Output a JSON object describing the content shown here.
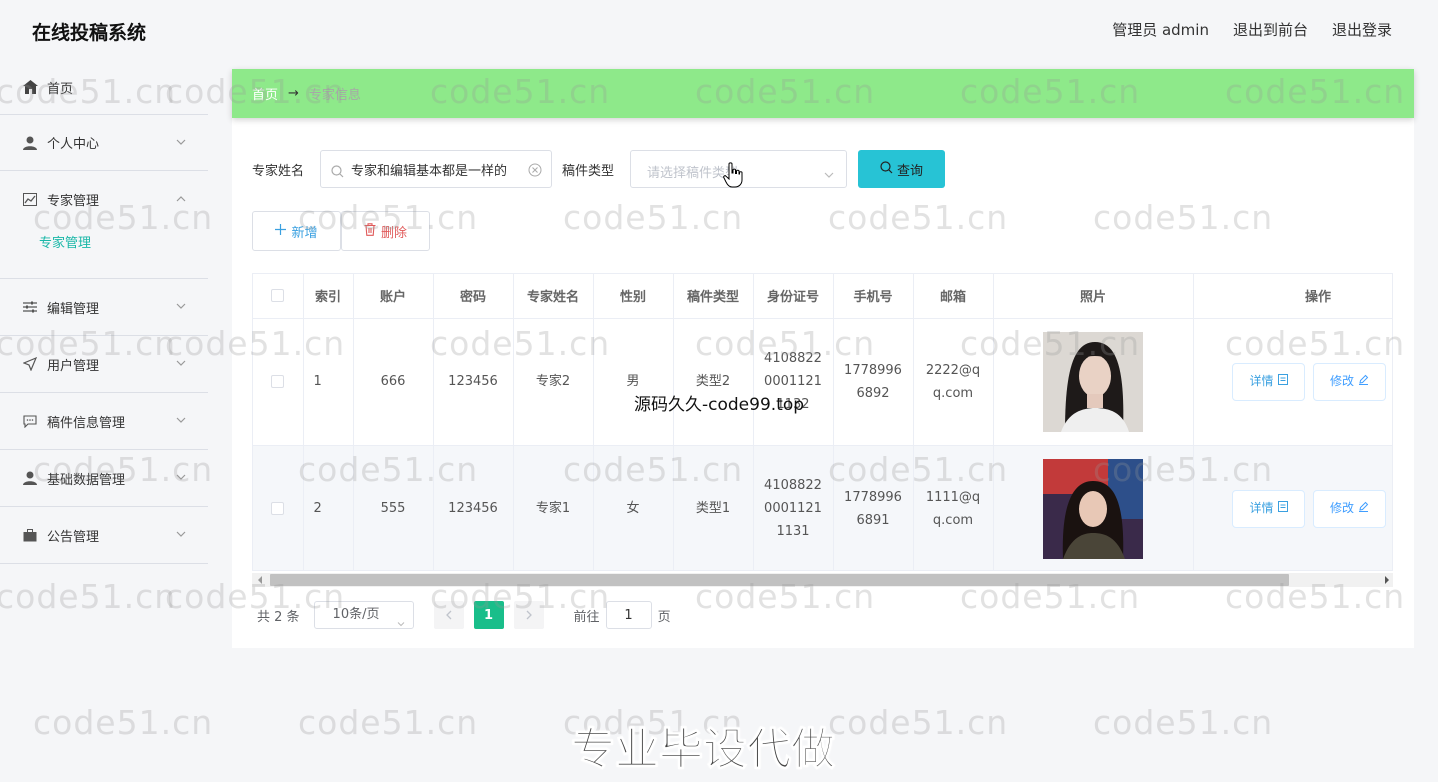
{
  "app": {
    "title": "在线投稿系统"
  },
  "header_links": {
    "admin": "管理员 admin",
    "to_front": "退出到前台",
    "logout": "退出登录"
  },
  "sidebar": {
    "home": "首页",
    "personal": "个人中心",
    "expert_mgmt": "专家管理",
    "expert_sub": "专家管理",
    "editor_mgmt": "编辑管理",
    "user_mgmt": "用户管理",
    "manuscript_mgmt": "稿件信息管理",
    "basic_data_mgmt": "基础数据管理",
    "notice_mgmt": "公告管理"
  },
  "breadcrumb": {
    "home": "首页",
    "arrow": "→",
    "current": "专家信息"
  },
  "filters": {
    "name_label": "专家姓名",
    "name_value": "专家和编辑基本都是一样的",
    "type_label": "稿件类型",
    "type_placeholder": "请选择稿件类型",
    "query_label": "查询"
  },
  "actions": {
    "add": "新增",
    "delete": "删除"
  },
  "table": {
    "columns": [
      "索引",
      "账户",
      "密码",
      "专家姓名",
      "性别",
      "稿件类型",
      "身份证号",
      "手机号",
      "邮箱",
      "照片",
      "操作"
    ],
    "rows": [
      {
        "index": "1",
        "account": "666",
        "password": "123456",
        "name": "专家2",
        "gender": "男",
        "type": "类型2",
        "id_card": "410882200011211132",
        "phone": "17789966892",
        "email": "2222@qq.com"
      },
      {
        "index": "2",
        "account": "555",
        "password": "123456",
        "name": "专家1",
        "gender": "女",
        "type": "类型1",
        "id_card": "410882200011211131",
        "phone": "17789966891",
        "email": "1111@qq.com"
      }
    ],
    "detail_label": "详情",
    "edit_label": "修改"
  },
  "pagination": {
    "total": "共 2 条",
    "page_size": "10条/页",
    "current_page": "1",
    "goto_label": "前往",
    "goto_value": "1",
    "page_unit": "页"
  },
  "watermark": "code51.cn",
  "overlay_text": "源码久久-code99.top",
  "banner": "专业毕设代做",
  "colors": {
    "accent": "#27c3d5",
    "breadcrumb_bg": "#8ee98a",
    "active_page": "#19be8a",
    "sub_active": "#19b7a7"
  }
}
